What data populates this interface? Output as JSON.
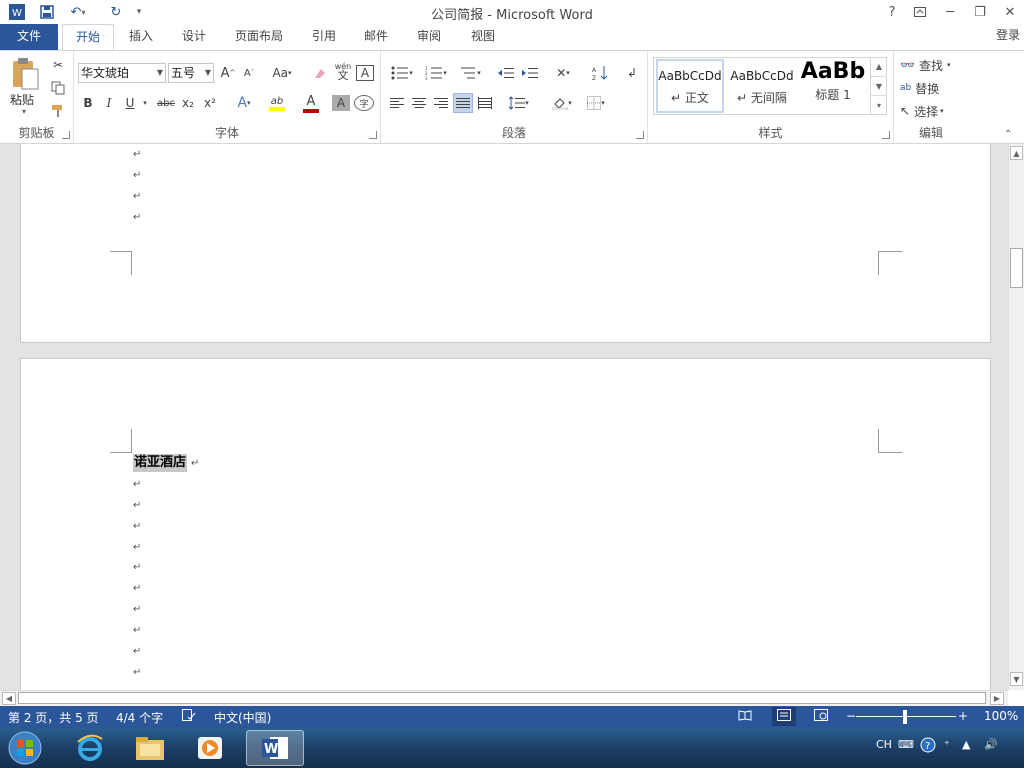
{
  "titlebar": {
    "doc_title": "公司简报 - Microsoft Word",
    "help": "?",
    "word_icon": "W"
  },
  "tabs": {
    "file": "文件",
    "home": "开始",
    "insert": "插入",
    "design": "设计",
    "layout": "页面布局",
    "references": "引用",
    "mailings": "邮件",
    "review": "审阅",
    "view": "视图",
    "login": "登录"
  },
  "ribbon": {
    "clipboard": {
      "label": "剪贴板",
      "paste": "粘贴"
    },
    "font": {
      "label": "字体",
      "font_name": "华文琥珀",
      "font_size": "五号",
      "grow": "A",
      "shrink": "A",
      "case": "Aa",
      "bold": "B",
      "italic": "I",
      "underline": "U",
      "strike": "abc",
      "sub": "x₂",
      "sup": "x²",
      "pinyin_top": "wén",
      "pinyin_bottom": "文",
      "border_char": "A",
      "effects": "A",
      "highlight": "ab",
      "font_color": "A",
      "shading": "A",
      "enclose": "字"
    },
    "paragraph": {
      "label": "段落"
    },
    "styles": {
      "label": "样式",
      "items": [
        {
          "preview": "AaBbCcDd",
          "name": "正文"
        },
        {
          "preview": "AaBbCcDd",
          "name": "无间隔"
        },
        {
          "preview": "AaBb",
          "name": "标题 1"
        }
      ]
    },
    "editing": {
      "label": "编辑",
      "find": "查找",
      "replace": "替换",
      "select": "选择"
    }
  },
  "document": {
    "heading_text": "诺亚酒店",
    "para_mark": "↵"
  },
  "statusbar": {
    "page": "第 2 页，共 5 页",
    "words": "4/4 个字",
    "language": "中文(中国)",
    "zoom": "100%"
  },
  "taskbar": {
    "tray_lang": "CH"
  },
  "colors": {
    "accent": "#2b579a",
    "highlight": "#ffff00",
    "font_color_bar": "#c00000"
  }
}
